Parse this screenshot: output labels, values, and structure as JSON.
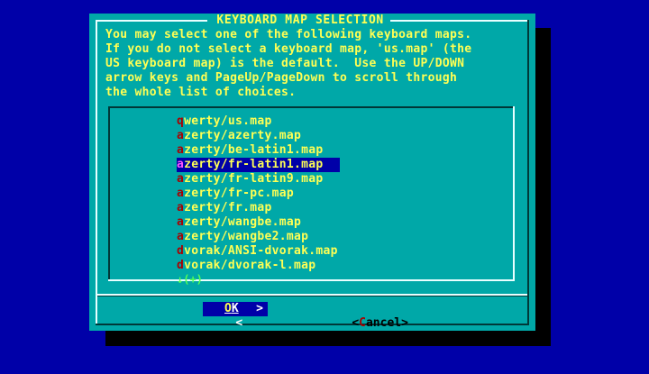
{
  "dialog": {
    "title": " KEYBOARD MAP SELECTION ",
    "description": "You may select one of the following keyboard maps.\nIf you do not select a keyboard map, 'us.map' (the\nUS keyboard map) is the default.  Use the UP/DOWN\narrow keys and PageUp/PageDown to scroll through\nthe whole list of choices."
  },
  "list": {
    "items": [
      {
        "hot": "q",
        "rest": "werty/us.map",
        "selected": false
      },
      {
        "hot": "a",
        "rest": "zerty/azerty.map",
        "selected": false
      },
      {
        "hot": "a",
        "rest": "zerty/be-latin1.map",
        "selected": false
      },
      {
        "hot": "a",
        "rest": "zerty/fr-latin1.map",
        "selected": true
      },
      {
        "hot": "a",
        "rest": "zerty/fr-latin9.map",
        "selected": false
      },
      {
        "hot": "a",
        "rest": "zerty/fr-pc.map",
        "selected": false
      },
      {
        "hot": "a",
        "rest": "zerty/fr.map",
        "selected": false
      },
      {
        "hot": "a",
        "rest": "zerty/wangbe.map",
        "selected": false
      },
      {
        "hot": "a",
        "rest": "zerty/wangbe2.map",
        "selected": false
      },
      {
        "hot": "d",
        "rest": "vorak/ANSI-dvorak.map",
        "selected": false
      },
      {
        "hot": "d",
        "rest": "vorak/dvorak-l.map",
        "selected": false
      }
    ],
    "more_indicator": "↓(+)"
  },
  "buttons": {
    "ok": {
      "left_arrow": "<",
      "hot": "O",
      "rest": "K",
      "right_arrow": ">"
    },
    "cancel": {
      "left_arrow": "<",
      "hot": "C",
      "rest": "ancel",
      "right_arrow": ">"
    }
  }
}
